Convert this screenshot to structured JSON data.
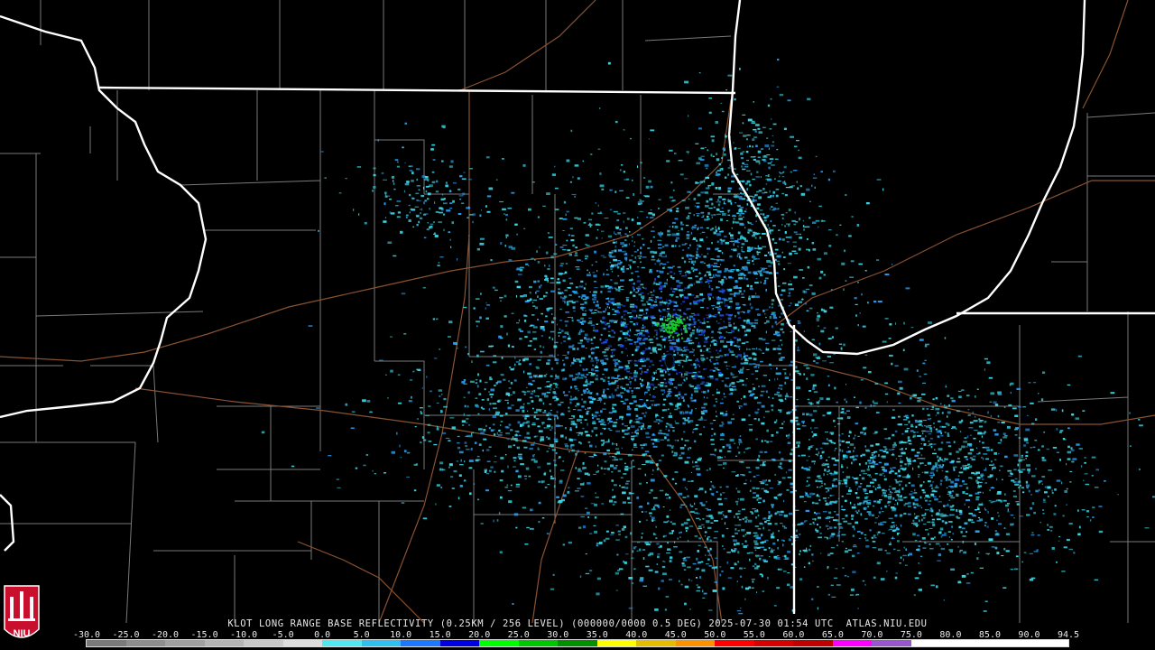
{
  "product_caption": "KLOT LONG RANGE BASE REFLECTIVITY (0.25KM / 256 LEVEL) (000000/0000 0.5 DEG) 2025-07-30 01:54 UTC  ATLAS.NIU.EDU",
  "scale": {
    "labels": [
      "-30.0",
      "-25.0",
      "-20.0",
      "-15.0",
      "-10.0",
      "-5.0",
      "0.0",
      "5.0",
      "10.0",
      "15.0",
      "20.0",
      "25.0",
      "30.0",
      "35.0",
      "40.0",
      "45.0",
      "50.0",
      "55.0",
      "60.0",
      "65.0",
      "70.0",
      "75.0",
      "80.0",
      "85.0",
      "90.0",
      "94.5"
    ],
    "colors": [
      "#7a7a7a",
      "#8d8d8d",
      "#a0a0a0",
      "#b4b4b4",
      "#c8c8c8",
      "#dcdcdc",
      "#50e8f0",
      "#2fc0f0",
      "#1e78ff",
      "#0000e0",
      "#00ff00",
      "#00c800",
      "#009000",
      "#ffff00",
      "#e6bc00",
      "#ff9000",
      "#ff0000",
      "#d60000",
      "#c00000",
      "#ff00ff",
      "#9955cc",
      "#ffffff",
      "#ffffff",
      "#ffffff",
      "#ffffff"
    ]
  },
  "logo": {
    "text": "NIU",
    "color": "#c8102e"
  },
  "map_colors": {
    "background": "#000000",
    "state_lines": "#ffffff",
    "county_lines": "#9a9a9a",
    "roads": "#8a5230",
    "echo_light": "#3cd8e8",
    "echo_mid": "#2a9cf0",
    "echo_strong": "#1e4ce0",
    "echo_green": "#18c828"
  }
}
